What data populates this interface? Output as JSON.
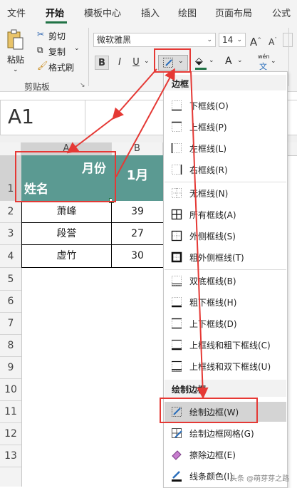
{
  "ribbon": {
    "tabs": [
      "文件",
      "开始",
      "模板中心",
      "插入",
      "绘图",
      "页面布局",
      "公式"
    ],
    "active_tab": "开始",
    "clipboard": {
      "paste_label": "粘贴",
      "cut_label": "剪切",
      "copy_label": "复制",
      "format_painter_label": "格式刷",
      "group_label": "剪贴板"
    },
    "font": {
      "font_name": "微软雅黑",
      "font_size": "14",
      "grow_label": "A",
      "shrink_label": "A",
      "bold": "B",
      "italic": "I",
      "underline": "U",
      "font_color_label": "A",
      "phonetic_top": "wén",
      "phonetic_bottom": "文"
    }
  },
  "name_box": {
    "value": "A1"
  },
  "sheet": {
    "columns": [
      "A",
      "B"
    ],
    "rows": [
      "1",
      "2",
      "3",
      "4",
      "5",
      "6",
      "7",
      "8",
      "9",
      "10",
      "11",
      "12",
      "13"
    ],
    "header_cell": {
      "top": "月份",
      "bottom": "姓名"
    },
    "b1": "1月",
    "data": [
      {
        "name": "萧峰",
        "value": "39"
      },
      {
        "name": "段誉",
        "value": "27"
      },
      {
        "name": "虚竹",
        "value": "30"
      }
    ],
    "header_color": "#5b9a92"
  },
  "border_menu": {
    "section_borders": "边框",
    "items_group1": [
      {
        "label": "下框线(O)",
        "icon": "bottom-border-icon"
      },
      {
        "label": "上框线(P)",
        "icon": "top-border-icon"
      },
      {
        "label": "左框线(L)",
        "icon": "left-border-icon"
      },
      {
        "label": "右框线(R)",
        "icon": "right-border-icon"
      }
    ],
    "items_group2": [
      {
        "label": "无框线(N)",
        "icon": "no-border-icon"
      },
      {
        "label": "所有框线(A)",
        "icon": "all-borders-icon"
      },
      {
        "label": "外侧框线(S)",
        "icon": "outside-borders-icon"
      },
      {
        "label": "粗外侧框线(T)",
        "icon": "thick-outside-borders-icon"
      }
    ],
    "items_group3": [
      {
        "label": "双底框线(B)",
        "icon": "double-bottom-border-icon"
      },
      {
        "label": "粗下框线(H)",
        "icon": "thick-bottom-border-icon"
      },
      {
        "label": "上下框线(D)",
        "icon": "top-bottom-border-icon"
      },
      {
        "label": "上框线和粗下框线(C)",
        "icon": "top-thick-bottom-border-icon"
      },
      {
        "label": "上框线和双下框线(U)",
        "icon": "top-double-bottom-border-icon"
      }
    ],
    "section_draw": "绘制边框",
    "items_draw": [
      {
        "label": "绘制边框(W)",
        "icon": "draw-border-icon"
      },
      {
        "label": "绘制边框网格(G)",
        "icon": "draw-border-grid-icon"
      },
      {
        "label": "擦除边框(E)",
        "icon": "eraser-icon"
      },
      {
        "label": "线条颜色(I)",
        "icon": "line-color-icon"
      }
    ]
  },
  "watermark": "头条 @萌芽芽之路",
  "colors": {
    "accent_green": "#217346",
    "annotation_red": "#e53935",
    "selected_item": "#d4d4d4"
  }
}
